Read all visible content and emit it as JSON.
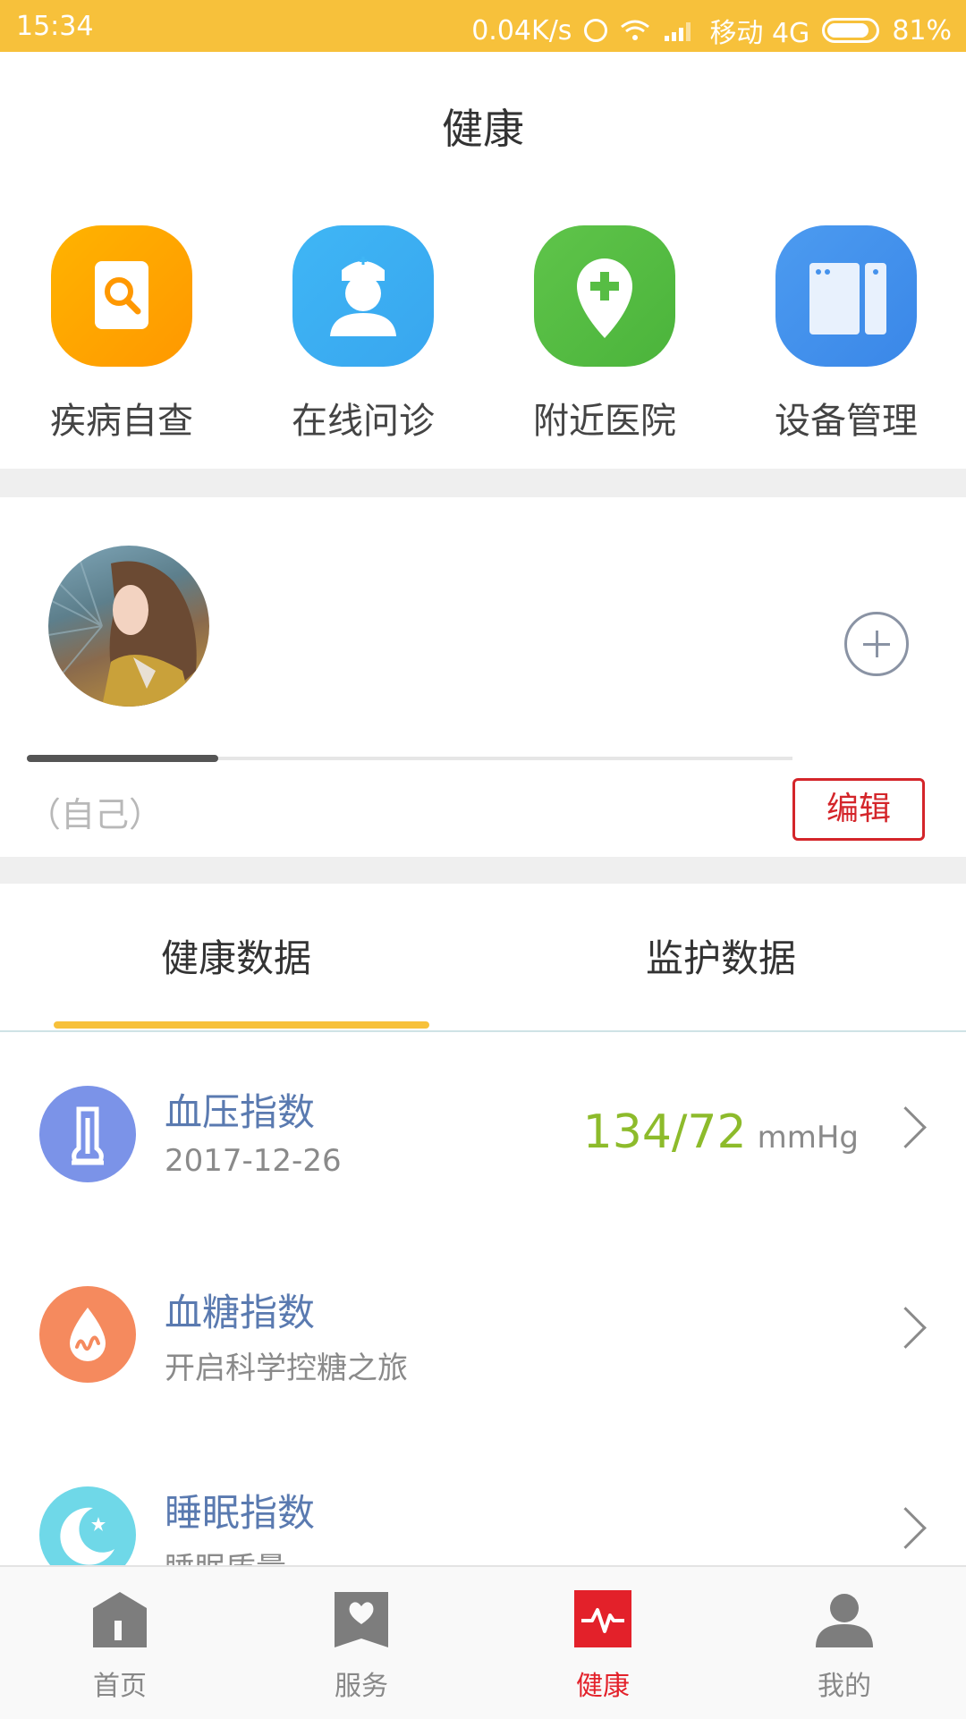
{
  "status_bar": {
    "time": "15:34",
    "speed": "0.04K/s",
    "carrier": "移动 4G",
    "battery": "81%",
    "battery_level": 0.81
  },
  "header": {
    "title": "健康"
  },
  "quick_actions": [
    {
      "label": "疾病自查",
      "icon": "search-document-icon",
      "color": "#ffa800"
    },
    {
      "label": "在线问诊",
      "icon": "doctor-icon",
      "color": "#3db0f3"
    },
    {
      "label": "附近医院",
      "icon": "location-plus-icon",
      "color": "#57bd44"
    },
    {
      "label": "设备管理",
      "icon": "devices-icon",
      "color": "#4592ec"
    }
  ],
  "profile": {
    "member_name": "（自己）",
    "edit_label": "编辑",
    "carousel_position": 0.25
  },
  "tabs": [
    {
      "label": "健康数据",
      "active": true
    },
    {
      "label": "监护数据",
      "active": false
    }
  ],
  "health_items": [
    {
      "title": "血压指数",
      "subtitle": "2017-12-26",
      "value": "134/72",
      "unit": "mmHg",
      "icon": "thermometer-icon",
      "color": "#7b93e8"
    },
    {
      "title": "血糖指数",
      "subtitle": "开启科学控糖之旅",
      "value": "",
      "unit": "",
      "icon": "blood-drop-icon",
      "color": "#f58a5e"
    },
    {
      "title": "睡眠指数",
      "subtitle": "睡眠质量",
      "value": "",
      "unit": "",
      "icon": "moon-icon",
      "color": "#6fd8e8"
    }
  ],
  "bottom_nav": [
    {
      "label": "首页",
      "icon": "home-icon",
      "active": false
    },
    {
      "label": "服务",
      "icon": "heart-card-icon",
      "active": false
    },
    {
      "label": "健康",
      "icon": "heartbeat-icon",
      "active": true
    },
    {
      "label": "我的",
      "icon": "person-icon",
      "active": false
    }
  ],
  "colors": {
    "accent": "#f7c13b",
    "active_red": "#e3212a",
    "value_green": "#8dbb2b",
    "title_blue": "#5a7ab0"
  }
}
